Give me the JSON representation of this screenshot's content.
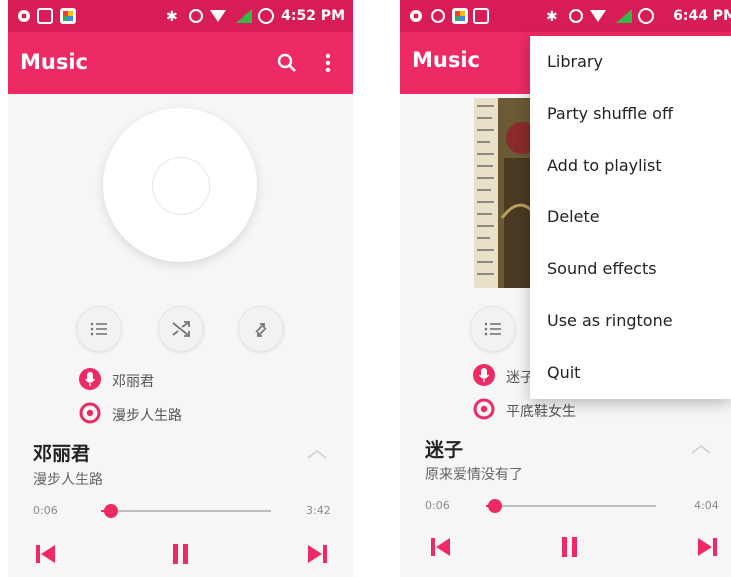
{
  "left": {
    "status": {
      "time": "4:52 PM"
    },
    "app_title": "Music",
    "artist": "邓丽君",
    "album": "漫步人生路",
    "now_playing_title": "邓丽君",
    "now_playing_sub": "漫步人生路",
    "elapsed": "0:06",
    "duration": "3:42",
    "progress": 0.06
  },
  "right": {
    "status": {
      "time": "6:44 PM"
    },
    "app_title": "Music",
    "artist": "迷子",
    "album": "平底鞋女生",
    "now_playing_title": "迷子",
    "now_playing_sub": "原来爱情没有了",
    "elapsed": "0:06",
    "duration": "4:04",
    "progress": 0.05,
    "menu": [
      "Library",
      "Party shuffle off",
      "Add to playlist",
      "Delete",
      "Sound effects",
      "Use as ringtone",
      "Quit"
    ]
  },
  "colors": {
    "accent": "#ee2a64",
    "status_bar": "#d81d56"
  }
}
